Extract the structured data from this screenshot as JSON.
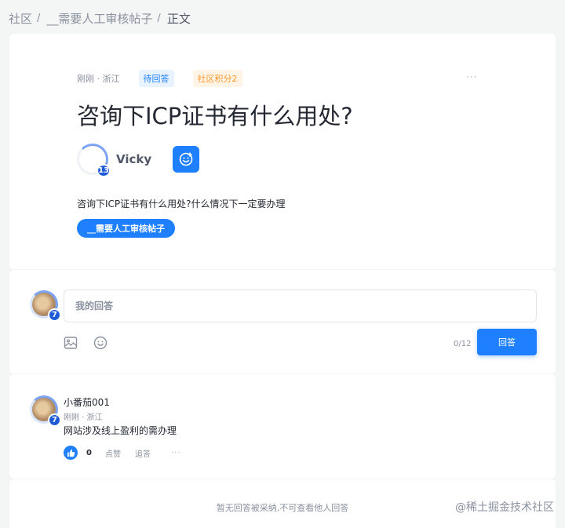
{
  "breadcrumb": {
    "items": [
      "社区",
      "__需要人工审核帖子",
      "正文"
    ],
    "separator": "/"
  },
  "question": {
    "time_location": "刚刚 · 浙江",
    "status_tag": "待回答",
    "points_tag": "社区积分2",
    "more": "···",
    "title": "咨询下ICP证书有什么用处?",
    "author": {
      "name": "Vicky",
      "level": "13"
    },
    "body": "咨询下ICP证书有什么用处?什么情况下一定要办理",
    "topic": "__需要人工审核帖子"
  },
  "answer_input": {
    "user_level": "7",
    "placeholder": "我的回答",
    "char_count": "0/12",
    "submit_label": "回答",
    "image_icon": "image-icon",
    "emoji_icon": "emoji-icon"
  },
  "answers": [
    {
      "name": "小番茄001",
      "level": "7",
      "meta": "刚刚 · 浙江",
      "body": "网站涉及线上盈利的需办理",
      "likes": "0",
      "like_label": "点赞",
      "reply_label": "追答",
      "more": "···"
    }
  ],
  "footer": {
    "note": "暂无回答被采纳,不可查看他人回答"
  },
  "watermark": "@稀土掘金技术社区",
  "colors": {
    "accent": "#1e80ff",
    "pending_bg": "#e8f3ff",
    "points_bg": "#fff4e5",
    "points_fg": "#ff9a2e"
  }
}
